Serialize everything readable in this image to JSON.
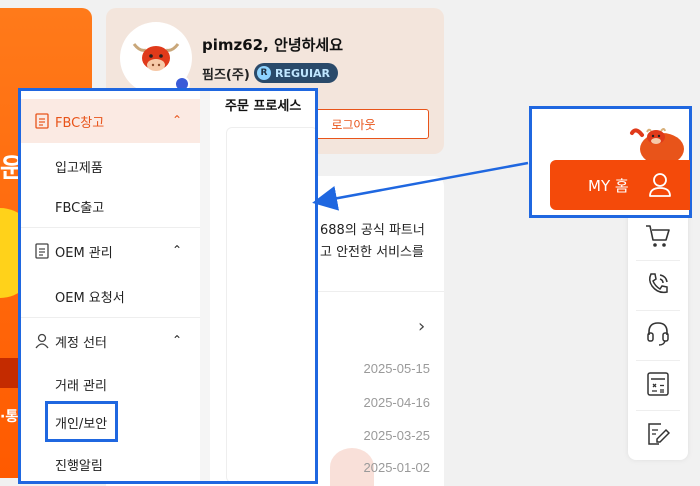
{
  "banner": {
    "text_top": "운",
    "text_bottom": "·통"
  },
  "profile": {
    "greeting": "pimz62, 안녕하세요",
    "company": "핌즈(주)",
    "level": "REGUIAR",
    "level_icon_letter": "R",
    "logout_label": "로그아웃"
  },
  "content": {
    "info_line1": "688의 공식 파트너",
    "info_line2": "고 안전한 서비스를",
    "dates": [
      "2025-05-15",
      "2025-04-16",
      "2025-03-25",
      "2025-01-02"
    ]
  },
  "menu": {
    "process_title": "주문 프로세스",
    "sections": [
      {
        "label": "FBC창고",
        "icon": "document-icon",
        "items": [
          "입고제품",
          "FBC출고"
        ]
      },
      {
        "label": "OEM 관리",
        "icon": "document-icon",
        "items": [
          "OEM 요청서"
        ]
      },
      {
        "label": "계정 선터",
        "icon": "user-icon",
        "items": [
          "거래 관리",
          "개인/보안",
          "진행알림"
        ]
      }
    ]
  },
  "myhome": {
    "label": "MY 홈"
  },
  "toolbar": [
    "cart-icon",
    "phone-icon",
    "headset-icon",
    "calculator-icon",
    "edit-icon"
  ],
  "colors": {
    "accent": "#f44a0a",
    "highlight": "#1f67e0",
    "active_menu": "#e8541a"
  }
}
